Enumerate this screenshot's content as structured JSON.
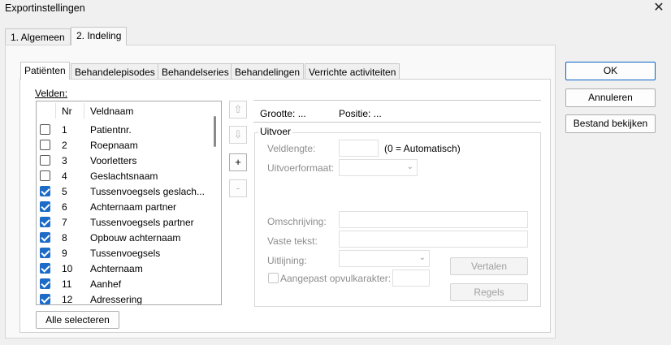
{
  "window": {
    "title": "Exportinstellingen",
    "close_glyph": "✕"
  },
  "outer_tabs": [
    {
      "label": "1. Algemeen"
    },
    {
      "label": "2. Indeling"
    }
  ],
  "inner_tabs": [
    {
      "label": "Patiënten"
    },
    {
      "label": "Behandelepisodes"
    },
    {
      "label": "Behandelseries"
    },
    {
      "label": "Behandelingen"
    },
    {
      "label": "Verrichte activiteiten"
    }
  ],
  "fields": {
    "label": "Velden:",
    "columns": {
      "nr": "Nr",
      "name": "Veldnaam"
    },
    "rows": [
      {
        "nr": "1",
        "name": "Patientnr.",
        "checked": false
      },
      {
        "nr": "2",
        "name": "Roepnaam",
        "checked": false
      },
      {
        "nr": "3",
        "name": "Voorletters",
        "checked": false
      },
      {
        "nr": "4",
        "name": "Geslachtsnaam",
        "checked": false
      },
      {
        "nr": "5",
        "name": "Tussenvoegsels geslach...",
        "checked": true
      },
      {
        "nr": "6",
        "name": "Achternaam partner",
        "checked": true
      },
      {
        "nr": "7",
        "name": "Tussenvoegsels partner",
        "checked": true
      },
      {
        "nr": "8",
        "name": "Opbouw achternaam",
        "checked": true
      },
      {
        "nr": "9",
        "name": "Tussenvoegsels",
        "checked": true
      },
      {
        "nr": "10",
        "name": "Achternaam",
        "checked": true
      },
      {
        "nr": "11",
        "name": "Aanhef",
        "checked": true
      },
      {
        "nr": "12",
        "name": "Adressering",
        "checked": true
      }
    ],
    "select_all_label": "Alle selecteren"
  },
  "side_buttons": {
    "up": "⇧",
    "down": "⇩",
    "add": "+",
    "remove": "-"
  },
  "info": {
    "size_label": "Grootte: ...",
    "position_label": "Positie: ..."
  },
  "output": {
    "group_label": "Uitvoer",
    "field_length_label": "Veldlengte:",
    "field_length_value": "",
    "field_length_hint": "(0 = Automatisch)",
    "output_format_label": "Uitvoerformaat:",
    "output_format_value": "",
    "description_label": "Omschrijving:",
    "description_value": "",
    "fixed_text_label": "Vaste tekst:",
    "fixed_text_value": "",
    "alignment_label": "Uitlijning:",
    "alignment_value": "",
    "custom_padding_label": "Aangepast opvulkarakter:",
    "custom_padding_value": "",
    "translate_label": "Vertalen",
    "rules_label": "Regels"
  },
  "actions": {
    "ok": "OK",
    "cancel": "Annuleren",
    "view_file": "Bestand bekijken"
  },
  "colors": {
    "accent": "#1c6bc6",
    "ok_border": "#0a64c8"
  }
}
